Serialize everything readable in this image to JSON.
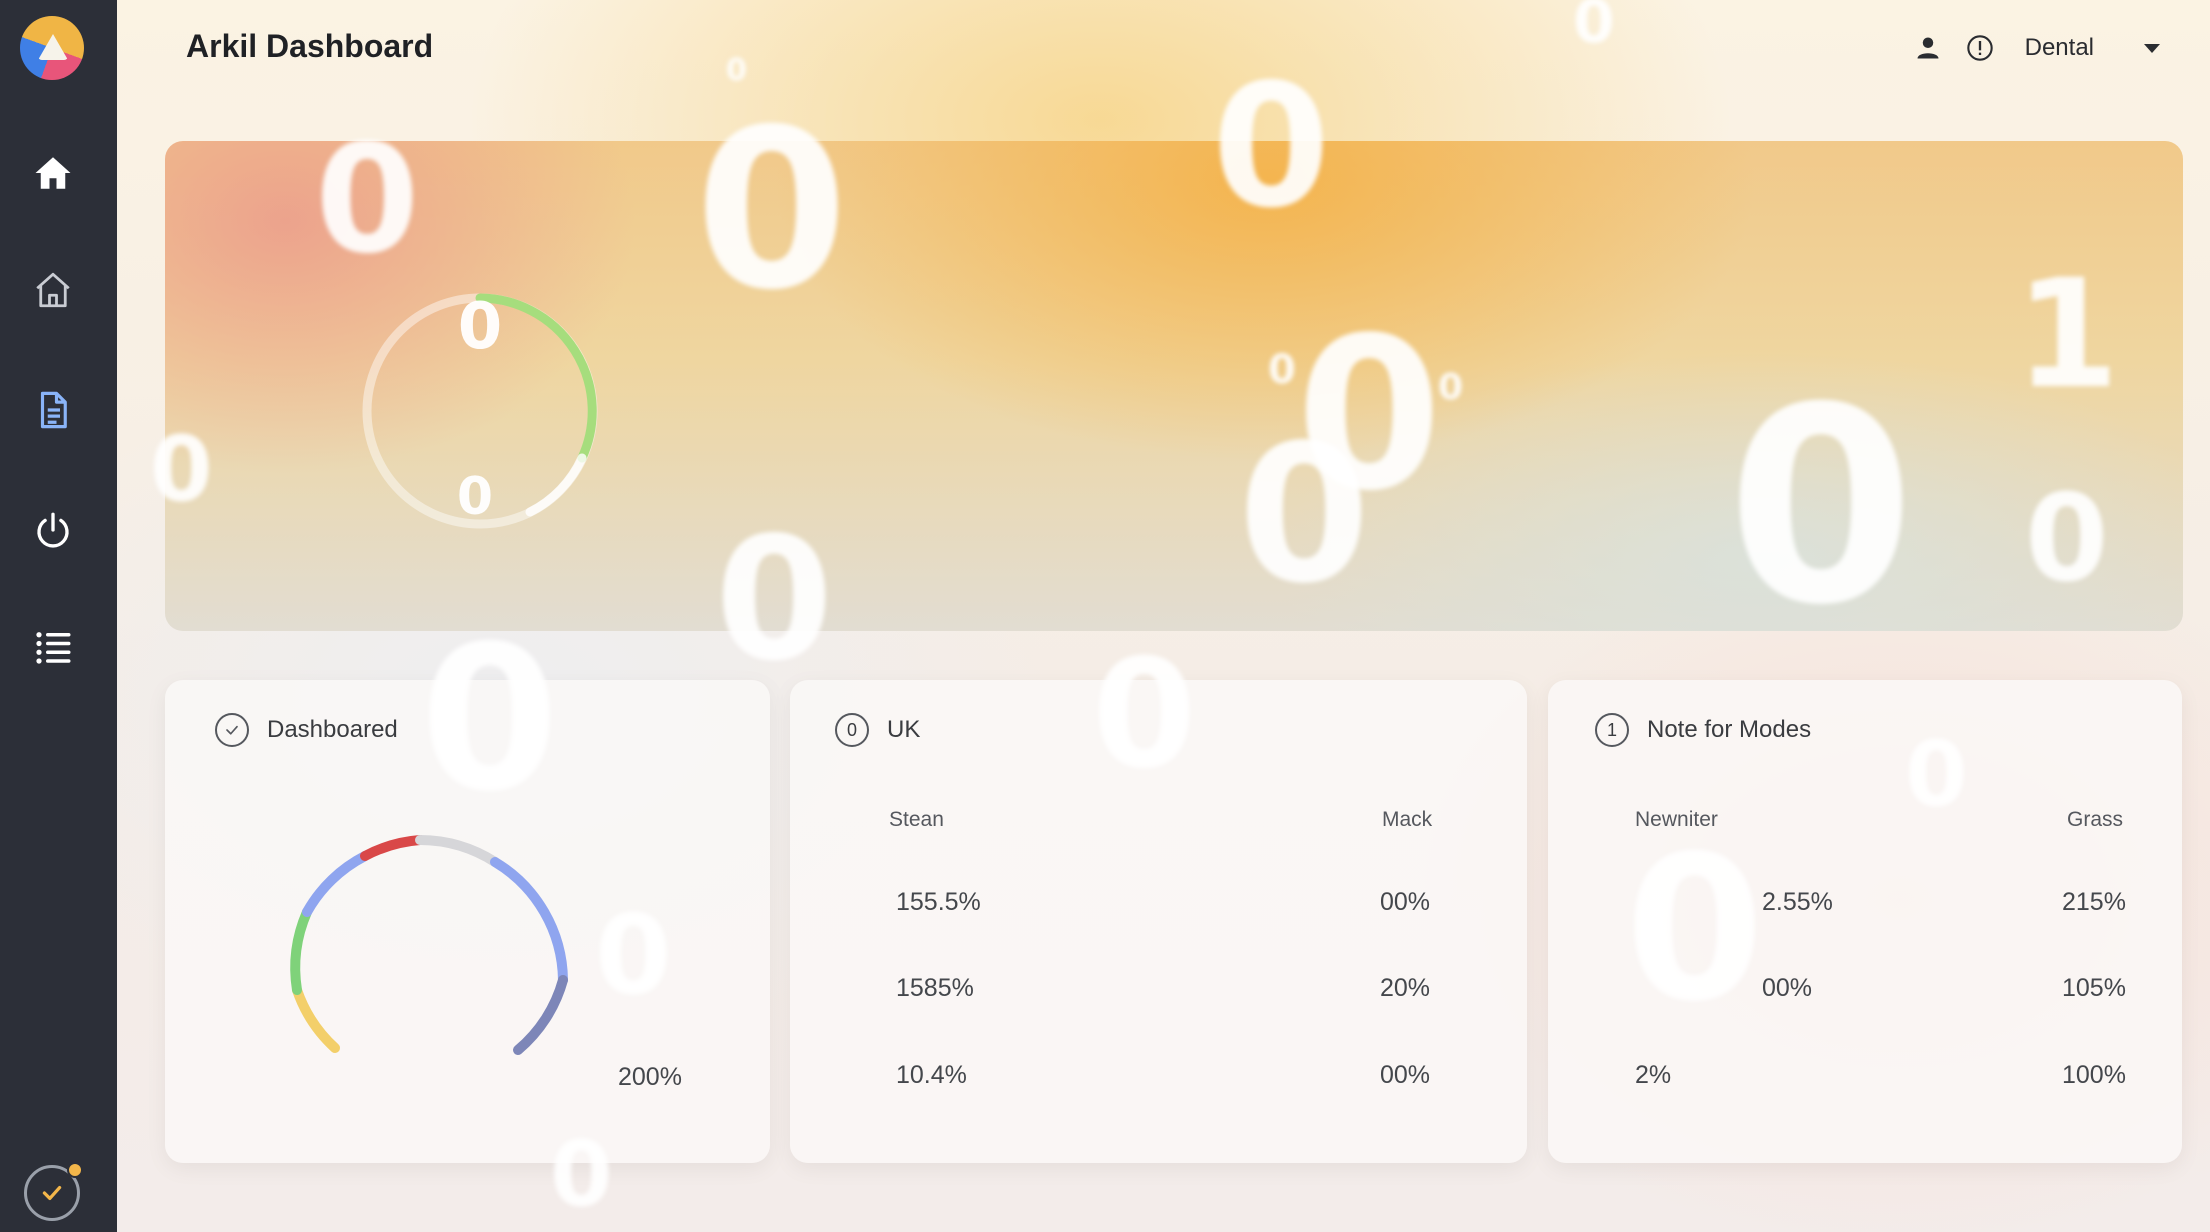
{
  "app": {
    "title": "Arkil Dashboard"
  },
  "header": {
    "selected_value": "Dental"
  },
  "hero": {
    "gauge_label_top": "0",
    "gauge_label_bottom": "0"
  },
  "cards": {
    "dashboard": {
      "badge_icon": "check-circle-icon",
      "title": "Dashboared",
      "gauge_value": "200%"
    },
    "uk": {
      "badge": "0",
      "title": "UK",
      "columns": [
        "Stean",
        "Mack"
      ],
      "rows": [
        [
          "155.5%",
          "00%"
        ],
        [
          "1585%",
          "20%"
        ],
        [
          "10.4%",
          "00%"
        ]
      ]
    },
    "notes": {
      "badge": "1",
      "title": "Note for Modes",
      "columns": [
        "Newniter",
        "Grass"
      ],
      "rows": [
        [
          "",
          "2.55%",
          "215%"
        ],
        [
          "",
          "00%",
          "105%"
        ],
        [
          "2%",
          "",
          "100%"
        ]
      ]
    }
  },
  "background_digits": [
    "0",
    "0",
    "0",
    "0",
    "0",
    "0",
    "0",
    "1",
    "0",
    "0",
    "0",
    "0",
    "0",
    "0",
    "0",
    "0",
    "0",
    "0",
    "0",
    "0"
  ],
  "colors": {
    "sidebar": "#2c2f38",
    "accent_blue": "#8fa5ef",
    "active_doc": "#8ab4f8"
  }
}
